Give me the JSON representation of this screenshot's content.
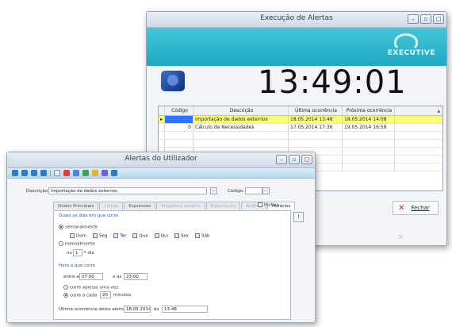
{
  "exec_window": {
    "title": "Execução de Alertas",
    "logo_text": "EXECUTIVE",
    "clock": "13:49:01",
    "columns": [
      "Código",
      "Descrição",
      "Última ocorrência",
      "Próxima ocorrência"
    ],
    "rows": [
      {
        "code": "",
        "desc": "Importação de dados externos",
        "last": "18.05.2014 13:48",
        "next": "18.05.2014 14:08"
      },
      {
        "code": "0",
        "desc": "Cálculo de Necessidades",
        "last": "17.05.2014 17:36",
        "next": "19.05.2014 16:59"
      }
    ],
    "close_label": "Fechar"
  },
  "alert_window": {
    "title": "Alertas do Utilizador",
    "description_label": "Descrição:",
    "description_value": "Importação de dados externos",
    "code_label": "Código:",
    "inactive_label": "Inativo",
    "tabs": [
      {
        "label": "Dados Principais",
        "state": "normal"
      },
      {
        "label": "Linhas",
        "state": "dim"
      },
      {
        "label": "Expressão",
        "state": "normal"
      },
      {
        "label": "Programa externo",
        "state": "dim"
      },
      {
        "label": "Exportação",
        "state": "dim"
      },
      {
        "label": "Análise",
        "state": "dim"
      },
      {
        "label": "Horários",
        "state": "active"
      }
    ],
    "section_days": "Quais os dias em que corre",
    "semanal_label": "semanalmente",
    "days": [
      "Dom",
      "Seg",
      "Ter",
      "Qua",
      "Qui",
      "Sex",
      "Sáb"
    ],
    "mensal_label": "mensalmente",
    "mensal_prefix": "no",
    "mensal_value": "1",
    "mensal_suffix": "º dia",
    "section_hours": "Hora a que corre",
    "from_label": "entre as",
    "from_value": "07:00",
    "to_label": "e as",
    "to_value": "23:00",
    "once_label": "corre apenas uma vez",
    "every_label": "corre a cada",
    "every_value": "20",
    "every_unit": "minutos",
    "last_label": "Última ocorrência deste alerta:",
    "last_date": "18.05.2014",
    "last_at": "às",
    "last_time": "13:48"
  }
}
